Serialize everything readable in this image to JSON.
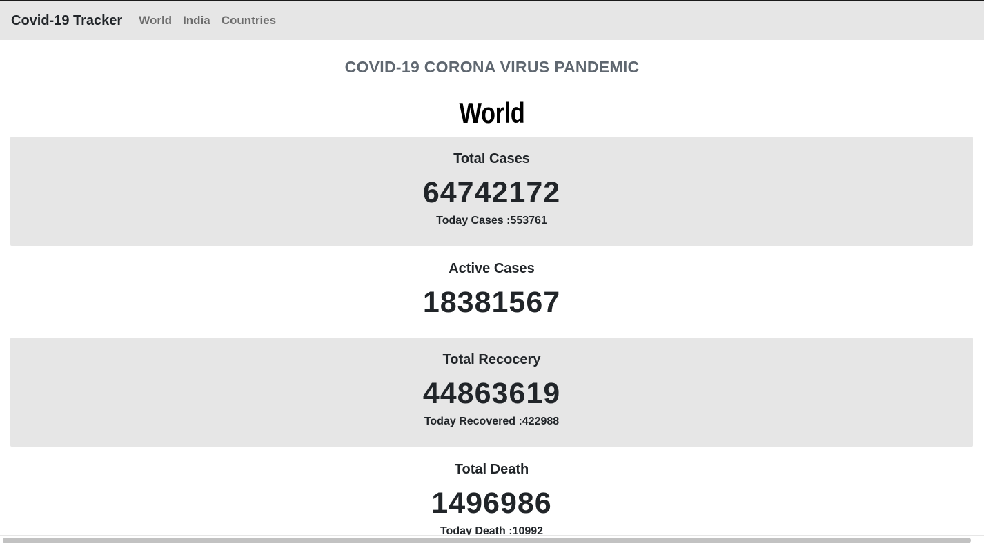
{
  "navbar": {
    "brand": "Covid-19 Tracker",
    "links": [
      "World",
      "India",
      "Countries"
    ]
  },
  "page": {
    "heading": "COVID-19 CORONA VIRUS PANDEMIC",
    "region": "World"
  },
  "stats": {
    "total_cases": {
      "label": "Total Cases",
      "value": "64742172",
      "sub": "Today Cases :553761"
    },
    "active_cases": {
      "label": "Active Cases",
      "value": "18381567"
    },
    "total_recovery": {
      "label": "Total Recocery",
      "value": "44863619",
      "sub": "Today Recovered :422988"
    },
    "total_death": {
      "label": "Total Death",
      "value": "1496986",
      "sub": "Today Death :10992"
    }
  }
}
